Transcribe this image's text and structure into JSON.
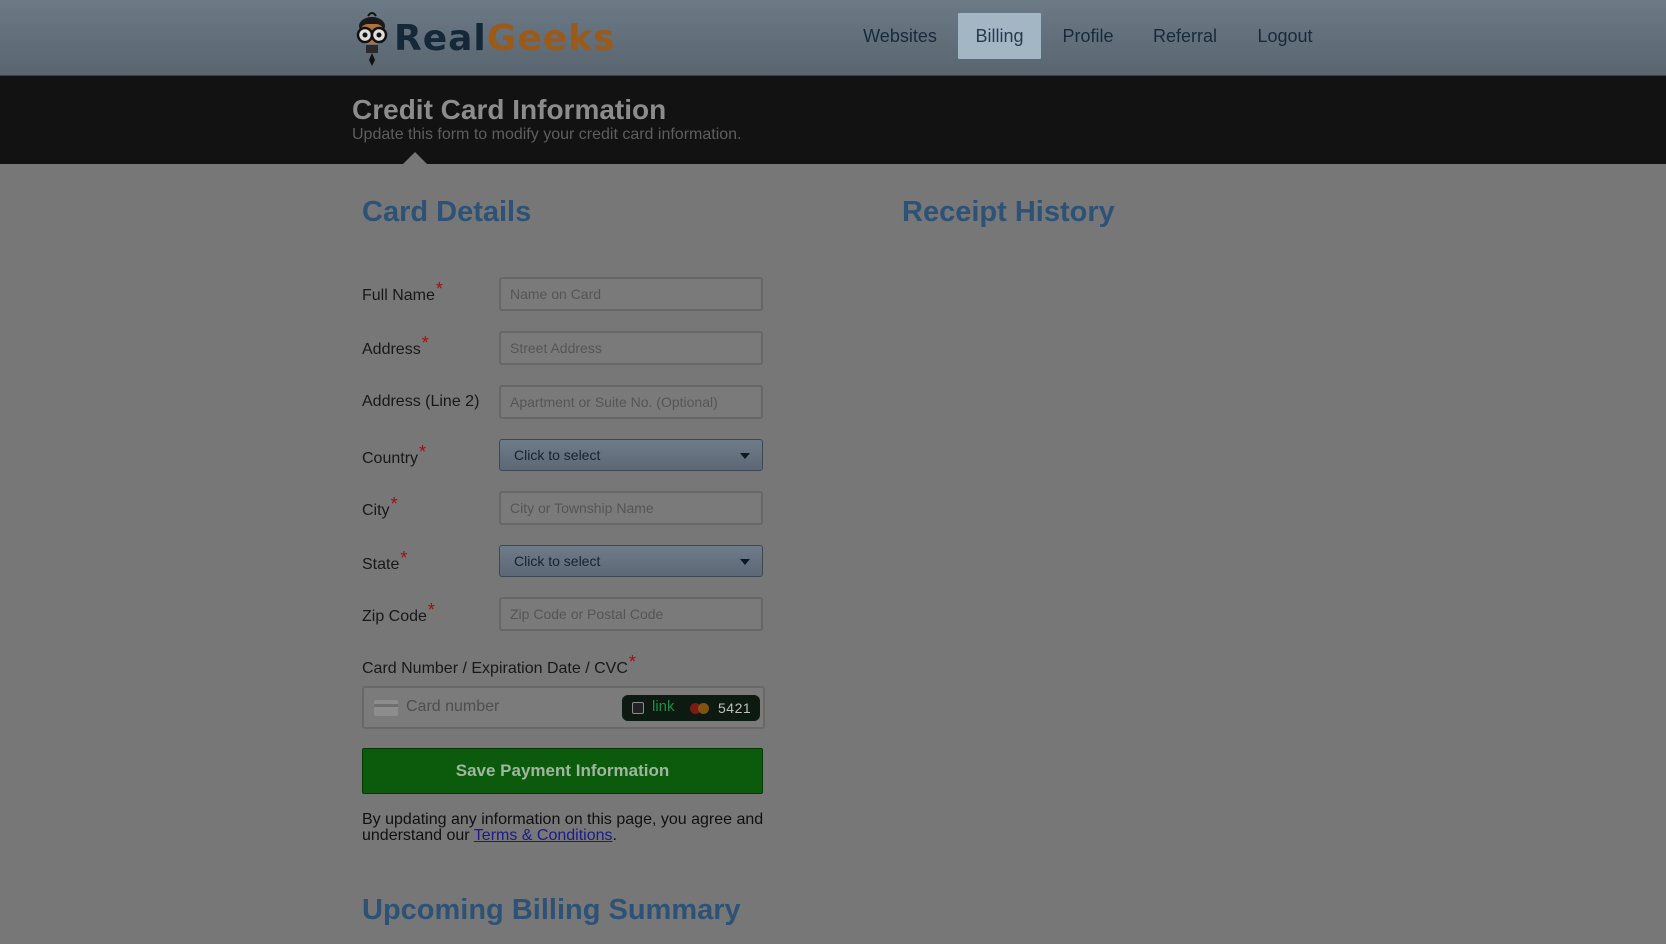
{
  "logo": {
    "text_part1": "Real",
    "text_part2": "Geeks"
  },
  "nav": {
    "items": [
      {
        "label": "Websites",
        "active": false
      },
      {
        "label": "Billing",
        "active": true
      },
      {
        "label": "Profile",
        "active": false
      },
      {
        "label": "Referral",
        "active": false
      },
      {
        "label": "Logout",
        "active": false
      }
    ]
  },
  "header": {
    "title": "Credit Card Information",
    "subtitle": "Update this form to modify your credit card information."
  },
  "card_details": {
    "title": "Card Details",
    "fields": {
      "full_name": {
        "label": "Full Name",
        "required": "*",
        "placeholder": "Name on Card",
        "value": ""
      },
      "address": {
        "label": "Address",
        "required": "*",
        "placeholder": "Street Address",
        "value": ""
      },
      "address2": {
        "label": "Address (Line 2)",
        "placeholder": "Apartment or Suite No. (Optional)",
        "value": ""
      },
      "country": {
        "label": "Country",
        "required": "*",
        "selected": "Click to select"
      },
      "city": {
        "label": "City",
        "required": "*",
        "placeholder": "City or Township Name",
        "value": ""
      },
      "state": {
        "label": "State",
        "required": "*",
        "selected": "Click to select"
      },
      "zip": {
        "label": "Zip Code",
        "required": "*",
        "placeholder": "Zip Code or Postal Code",
        "value": ""
      }
    },
    "card": {
      "label": "Card Number / Expiration Date / CVC",
      "required": "*",
      "placeholder": "Card number",
      "link_text": "link",
      "last4": "5421"
    },
    "save_label": "Save Payment Information",
    "agree_prefix": "By updating any information on this page, you agree and understand our",
    "terms_label": "Terms & Conditions",
    "agree_suffix": "."
  },
  "receipt_history": {
    "title": "Receipt History"
  },
  "billing_summary": {
    "title": "Upcoming Billing Summary"
  },
  "colors": {
    "section_title": "#2d5276",
    "save_button": "#0c5a0c",
    "required_star": "#a01010"
  }
}
